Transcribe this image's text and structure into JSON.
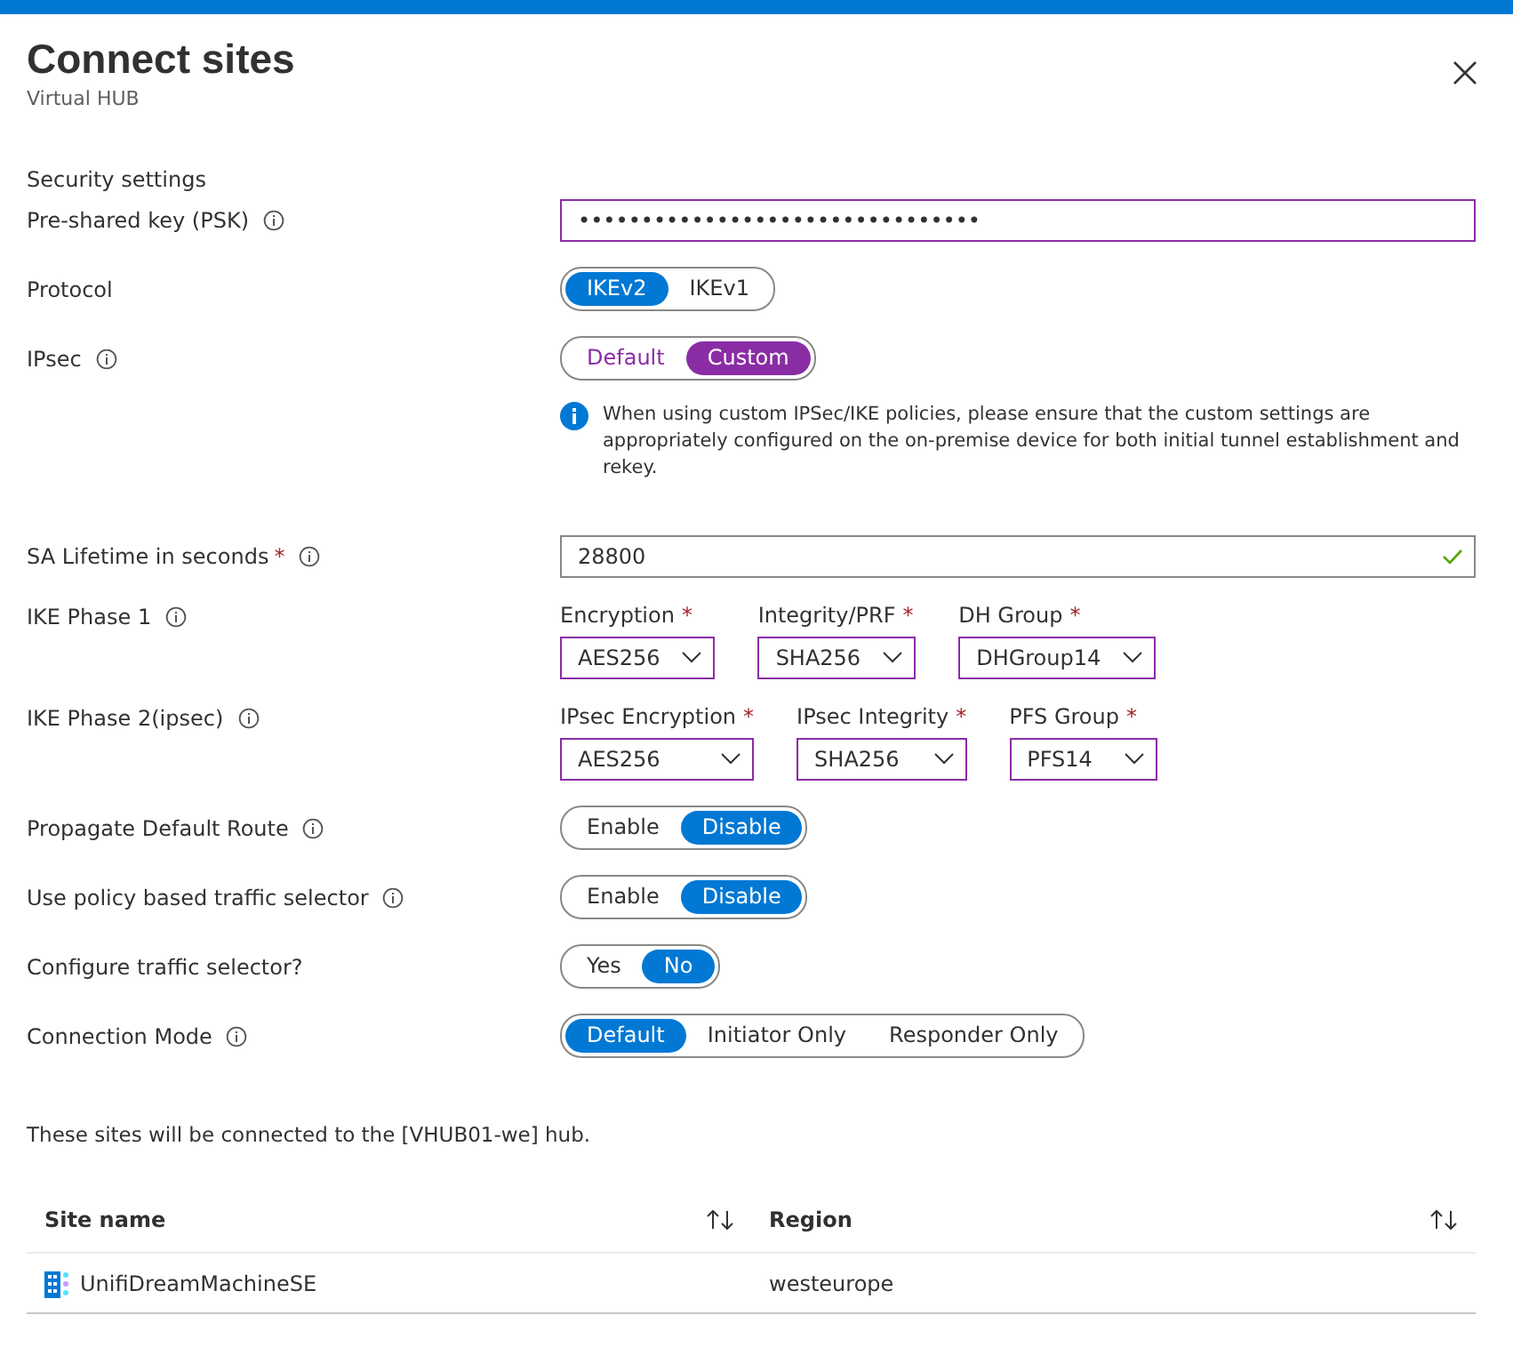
{
  "title": "Connect sites",
  "subtitle": "Virtual HUB",
  "section_heading": "Security settings",
  "rows": [
    {
      "kind": "password",
      "label": "Pre-shared key (PSK)",
      "info": true,
      "value": "••••••••••••••••••••••••••••••••",
      "modified": true
    },
    {
      "kind": "toggle",
      "label": "Protocol",
      "modified": false,
      "options": [
        {
          "label": "IKEv2",
          "selected": true
        },
        {
          "label": "IKEv1",
          "selected": false
        }
      ]
    },
    {
      "kind": "toggle",
      "label": "IPsec",
      "info": true,
      "modified": true,
      "options": [
        {
          "label": "Default",
          "selected": false
        },
        {
          "label": "Custom",
          "selected": true
        }
      ]
    },
    {
      "kind": "note",
      "text": "When using custom IPSec/IKE policies, please ensure that the custom settings are appropriately configured on the on-premise device for both initial tunnel establishment and rekey."
    },
    {
      "kind": "text",
      "label": "SA Lifetime in seconds",
      "required_mark": "*",
      "info": true,
      "value": "28800",
      "valid": true,
      "modified": false
    },
    {
      "kind": "dropdowns",
      "label": "IKE Phase 1",
      "info": true,
      "dropdowns": [
        {
          "label": "Encryption",
          "required_mark": "*",
          "value": "AES256",
          "modified": true
        },
        {
          "label": "Integrity/PRF",
          "required_mark": "*",
          "value": "SHA256",
          "modified": true
        },
        {
          "label": "DH Group",
          "required_mark": "*",
          "value": "DHGroup14",
          "modified": true
        }
      ]
    },
    {
      "kind": "dropdowns",
      "label": "IKE Phase 2(ipsec)",
      "info": true,
      "dropdowns": [
        {
          "label": "IPsec Encryption",
          "required_mark": "*",
          "value": "AES256",
          "modified": true
        },
        {
          "label": "IPsec Integrity",
          "required_mark": "*",
          "value": "SHA256",
          "modified": true
        },
        {
          "label": "PFS Group",
          "required_mark": "*",
          "value": "PFS14",
          "modified": true
        }
      ]
    },
    {
      "kind": "toggle",
      "label": "Propagate Default Route",
      "info": true,
      "modified": false,
      "options": [
        {
          "label": "Enable",
          "selected": false
        },
        {
          "label": "Disable",
          "selected": true
        }
      ]
    },
    {
      "kind": "toggle",
      "label": "Use policy based traffic selector",
      "info": true,
      "modified": false,
      "options": [
        {
          "label": "Enable",
          "selected": false
        },
        {
          "label": "Disable",
          "selected": true
        }
      ]
    },
    {
      "kind": "toggle",
      "label": "Configure traffic selector?",
      "modified": false,
      "options": [
        {
          "label": "Yes",
          "selected": false
        },
        {
          "label": "No",
          "selected": true
        }
      ]
    },
    {
      "kind": "toggle",
      "label": "Connection Mode",
      "info": true,
      "modified": false,
      "options": [
        {
          "label": "Default",
          "selected": true
        },
        {
          "label": "Initiator Only",
          "selected": false
        },
        {
          "label": "Responder Only",
          "selected": false
        }
      ]
    }
  ],
  "sites_text": "These sites will be connected to the [VHUB01-we] hub.",
  "table": {
    "columns": [
      "Site name",
      "Region"
    ],
    "rows": [
      {
        "cells": [
          "UnifiDreamMachineSE",
          "westeurope"
        ]
      }
    ]
  }
}
